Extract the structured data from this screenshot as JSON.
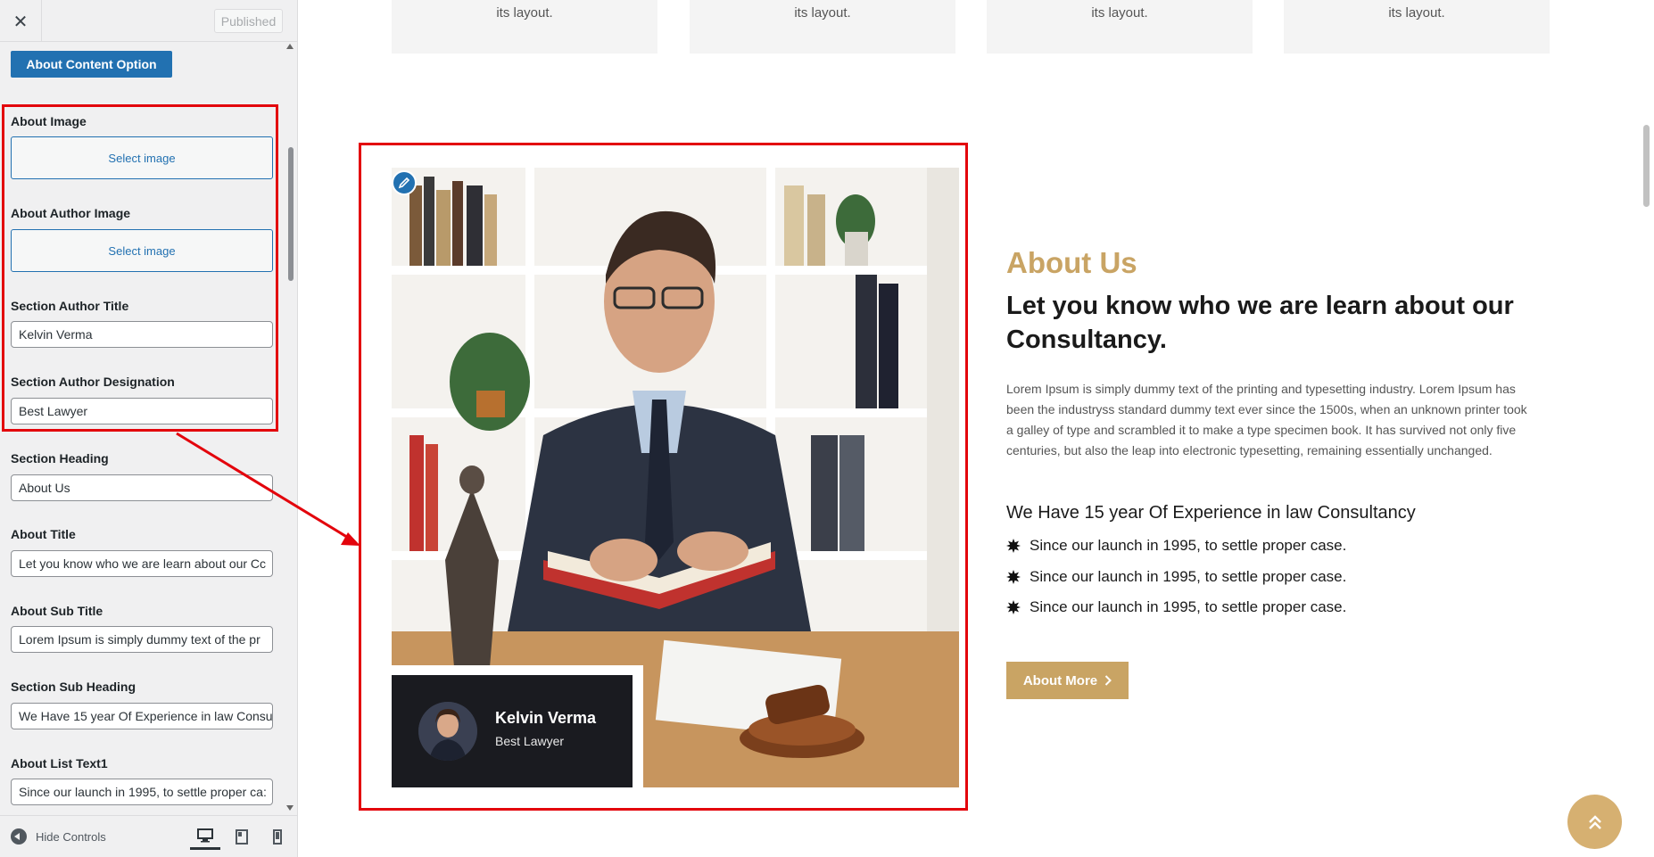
{
  "header": {
    "publish_label": "Published"
  },
  "section_button": "About Content Option",
  "controls": {
    "about_image_label": "About Image",
    "about_image_button": "Select image",
    "author_image_label": "About Author Image",
    "author_image_button": "Select image",
    "author_title_label": "Section Author Title",
    "author_title_value": "Kelvin Verma",
    "author_designation_label": "Section Author Designation",
    "author_designation_value": "Best Lawyer",
    "section_heading_label": "Section Heading",
    "section_heading_value": "About Us",
    "about_title_label": "About Title",
    "about_title_value": "Let you know who we are learn about our Cc",
    "about_subtitle_label": "About Sub Title",
    "about_subtitle_value": "Lorem Ipsum is simply dummy text of the pr",
    "section_subheading_label": "Section Sub Heading",
    "section_subheading_value": "We Have 15 year Of Experience in law Consu",
    "list_text1_label": "About List Text1",
    "list_text1_value": "Since our launch in 1995, to settle proper ca:"
  },
  "footer": {
    "hide_controls": "Hide Controls"
  },
  "preview": {
    "cards": [
      "its layout.",
      "its layout.",
      "its layout.",
      "its layout."
    ],
    "author_name": "Kelvin Verma",
    "author_role": "Best Lawyer",
    "heading": "About Us",
    "title": "Let you know who we are learn about our Consultancy.",
    "subtitle": "Lorem Ipsum is simply dummy text of the printing and typesetting industry. Lorem Ipsum has been the industryss standard dummy text ever since the 1500s, when an unknown printer took a galley of type and scrambled it to make a type specimen book. It has survived not only five centuries, but also the leap into electronic typesetting, remaining essentially unchanged.",
    "subheading": "We Have 15 year Of Experience in law Consultancy",
    "list": [
      "Since our launch in 1995, to settle proper case.",
      "Since our launch in 1995, to settle proper case.",
      "Since our launch in 1995, to settle proper case."
    ],
    "button": "About More"
  },
  "colors": {
    "accent_gold": "#c9a464",
    "wp_blue": "#2271b1",
    "highlight_red": "#e3040c",
    "author_card_bg": "#1a1b20"
  },
  "icons": [
    "close-icon",
    "pencil-icon",
    "chevron-right-icon",
    "double-chevron-up-icon",
    "desktop-icon",
    "tablet-icon",
    "mobile-icon",
    "starburst-bullet-icon"
  ]
}
